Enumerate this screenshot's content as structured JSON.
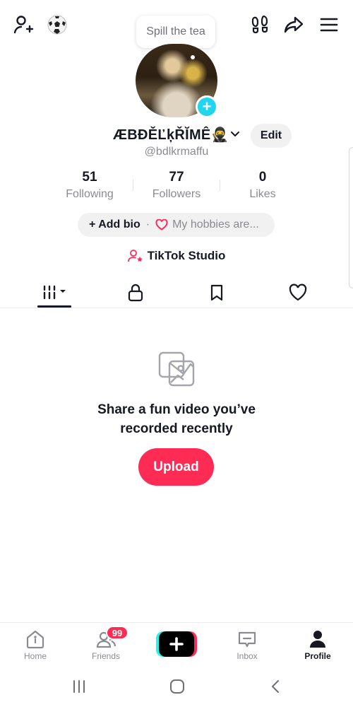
{
  "header": {
    "tooltip": "Spill the tea",
    "icons": [
      "add-friend-icon",
      "soccer-ball-icon",
      "footprints-icon",
      "share-icon",
      "menu-icon"
    ]
  },
  "profile": {
    "display_name": "ÆBĐĚĽķŘĬMÊ🥷",
    "username": "@bdlkrmaffu",
    "edit_label": "Edit",
    "stats": [
      {
        "value": "51",
        "label": "Following"
      },
      {
        "value": "77",
        "label": "Followers"
      },
      {
        "value": "0",
        "label": "Likes"
      }
    ],
    "add_bio_label": "+ Add bio",
    "bio_separator": "·",
    "hobbies_placeholder": "My hobbies are...",
    "studio_label": "TikTok Studio"
  },
  "tabs": [
    {
      "icon": "videos-grid-icon",
      "active": true
    },
    {
      "icon": "lock-icon",
      "active": false
    },
    {
      "icon": "bookmark-icon",
      "active": false
    },
    {
      "icon": "heart-icon",
      "active": false
    }
  ],
  "empty_state": {
    "line1": "Share a fun video you’ve",
    "line2": "recorded recently",
    "button": "Upload"
  },
  "bottom_nav": {
    "items": [
      {
        "label": "Home",
        "icon": "home-icon"
      },
      {
        "label": "Friends",
        "icon": "friends-icon"
      },
      {
        "label": "",
        "icon": "create-plus-icon"
      },
      {
        "label": "Inbox",
        "icon": "inbox-icon"
      },
      {
        "label": "Profile",
        "icon": "profile-icon",
        "active": true
      }
    ],
    "friends_badge": "99"
  },
  "system_nav": [
    "recent-apps-icon",
    "home-circle-icon",
    "back-chevron-icon"
  ],
  "colors": {
    "accent": "#fe2c55",
    "cyan": "#20d5ec",
    "text": "#161823",
    "muted": "#8a8b91"
  }
}
